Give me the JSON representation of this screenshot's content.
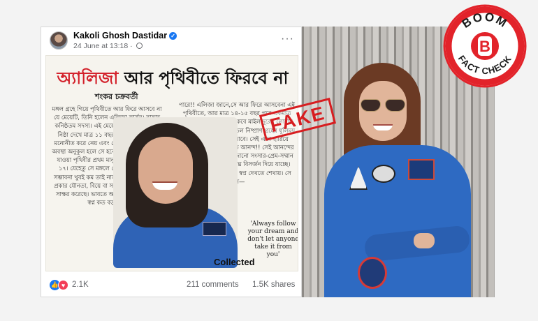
{
  "post": {
    "author": "Kakoli Ghosh Dastidar",
    "timestamp": "24 June at 13:18 ·",
    "reaction_count": "2.1K",
    "comments": "211 comments",
    "shares": "1.5K shares"
  },
  "clipping": {
    "headline_red": "অ্যালিজা",
    "headline_rest": " আর পৃথিবীতে ফিরবে না",
    "byline": "শংকর চক্রবর্তী",
    "col_left": "মঙ্গল গ্রহে গিয়ে পৃথিবীতে আর ফিরে আসবে না যে মেয়েটি, তিনি হলেন এলিজা কার্সন। নাসার কনিষ্ঠতম সদস্য। এই মেয়ের আগ্রহ তৃষ্ণা আর নিষ্ঠা দেখে মাত্র ১১ বছর বয়সে নাসা তাকে মনোনীত করে নেয় এবং ঘোষণা করে যে সমস্ত অবস্থা অনুকূল হলে সে হবে ২০৩৩ সালে মঙ্গলে যাওয়া পৃথিবীর প্রথম মানুষ। এখন তার বয়স ১৭। যেহেতু সে মঙ্গলে গেলে ফিরে আসার সম্ভাবনা খুবই কম তাই নাসার কাছে সে কোনও প্রকার যৌনতা, বিয়ে বা সন্তানধারণের বিষয়েও সাক্ষর করেছে। ভাবতে অবাক লাগে, মানুষের স্বপ্ন কত বড় হতে",
    "col_right": "পারে!! এলিজা জানে,সে আর ফিরে আসবেনা এই পৃথিবীতে, আর মাত্র ১৪-১৫ বছর পরে একমাত্র নিঃসঙ্গ মানুষ হিসেবে থাকবে মাইল দূরের লোহার লালচে মরুভূমি প্রচণ্ড শীতল নিষ্প্রাণ গ্রহের ধূলিময় নক্ষত্রের নিচে হারিয়ে যাবে। সেই একা হারিয়ে যাওয়া তার কাছে কত বড় আনন্দ!! সেই আনন্দের কাছে পৃথিবীর এ সব সাজানো সংসার-প্রেম-সম্মান এ সবের আবেদন নির্বিঘ্নে বিসর্জন দিয়ে যাচ্ছে। এলিজা কার্সন আমাদের স্বপ্ন দেখতে শেখায়। সে বলে—",
    "quote": "'Always follow your dream and don't let anyone take it from you'",
    "collected_label": "Collected"
  },
  "stamp": {
    "text": "FAKE",
    "color": "#d71d20"
  },
  "badge": {
    "top_text": "BOOM",
    "bottom_text": "FACT CHECK",
    "logo_letter": "B",
    "color": "#e2232a"
  },
  "icons": {
    "verified": "verified-badge-icon",
    "globe": "globe-icon",
    "more": "more-options-icon",
    "like": "like-reaction-icon",
    "love": "love-reaction-icon"
  }
}
